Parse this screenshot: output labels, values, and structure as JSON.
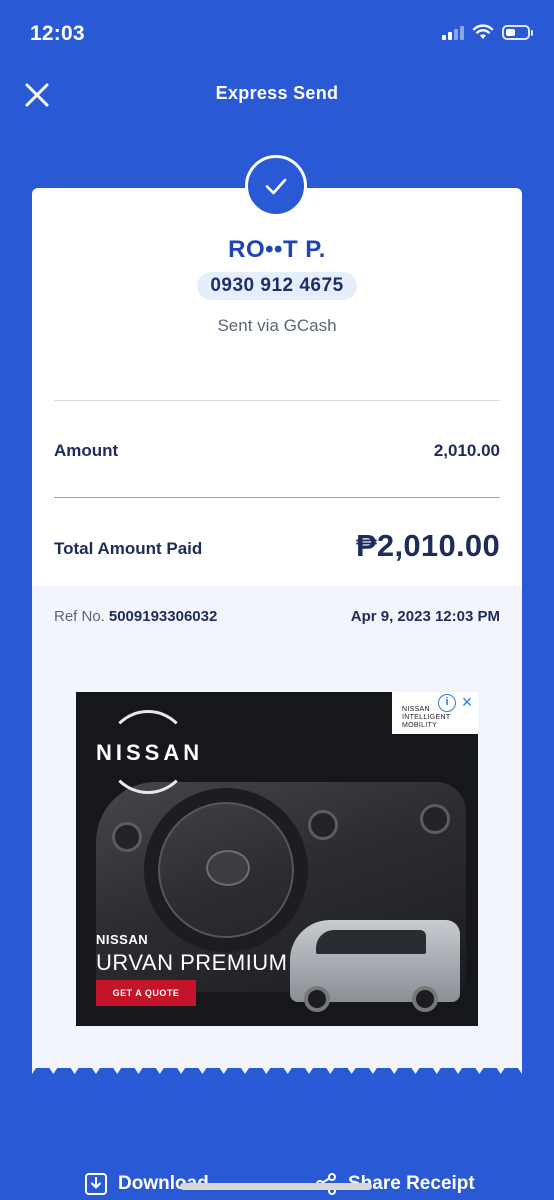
{
  "status_bar": {
    "time": "12:03",
    "battery_level": 0.45
  },
  "header": {
    "title": "Express Send",
    "close_icon": "close-icon"
  },
  "receipt": {
    "status_icon": "check-icon",
    "recipient_name": "RO••T P.",
    "recipient_number": "0930 912 4675",
    "sent_via": "Sent via GCash",
    "amount_label": "Amount",
    "amount_value": "2,010.00",
    "total_label": "Total Amount Paid",
    "total_value": "₱2,010.00",
    "ref_label": "Ref No.",
    "ref_number": "5009193306032",
    "date": "Apr 9, 2023 12:03 PM"
  },
  "ad": {
    "brand": "NISSAN",
    "corner_text": "NISSAN INTELLIGENT MOBILITY",
    "info_icon": "info-icon",
    "close_icon": "ad-close-icon",
    "model_brand": "NISSAN",
    "model": "URVAN PREMIUM",
    "cta": "GET A QUOTE"
  },
  "actions": {
    "download_label": "Download",
    "download_icon": "download-icon",
    "share_label": "Share Receipt",
    "share_icon": "share-icon"
  },
  "colors": {
    "brand_blue": "#2a59d6",
    "name_blue": "#1f44b4",
    "text_dark": "#1d2c5a",
    "cta_red": "#c3142a"
  }
}
